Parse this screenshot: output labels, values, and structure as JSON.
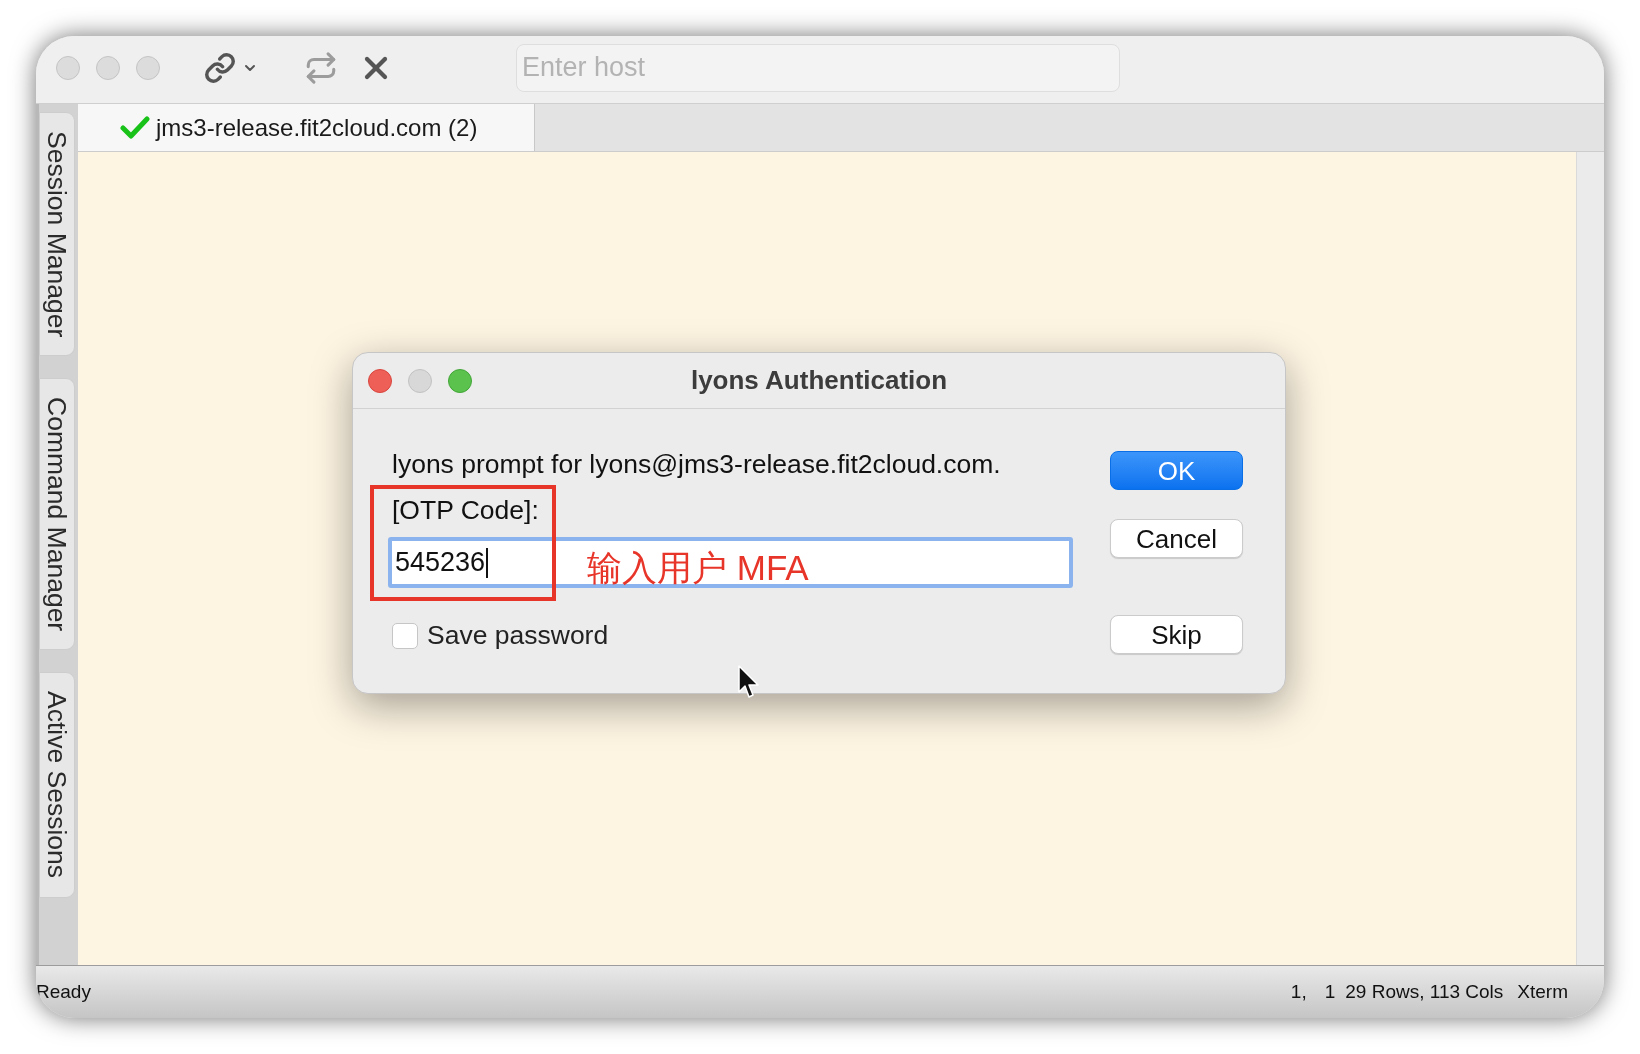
{
  "toolbar": {
    "host_field": {
      "placeholder": "Enter host"
    }
  },
  "tabs": [
    {
      "label": "jms3-release.fit2cloud.com (2)",
      "selected": true,
      "connected": true
    }
  ],
  "sidebar": {
    "items": [
      {
        "label": "Session Manager"
      },
      {
        "label": "Command Manager"
      },
      {
        "label": "Active Sessions"
      }
    ]
  },
  "dialog": {
    "title": "lyons Authentication",
    "prompt": "lyons prompt for lyons@jms3-release.fit2cloud.com.",
    "field_label": "[OTP Code]:",
    "otp_field": {
      "value": "545236",
      "focused": true
    },
    "save_password": {
      "label": "Save password",
      "checked": false
    },
    "buttons": [
      {
        "label": "OK",
        "kind": "primary"
      },
      {
        "label": "Cancel",
        "kind": "secondary"
      },
      {
        "label": "Skip",
        "kind": "secondary"
      }
    ]
  },
  "annotation": {
    "text": "输入用户 MFA"
  },
  "status_bar": {
    "message": "Ready",
    "cursor_line": "1,",
    "cursor_column": "1",
    "dimensions": "29 Rows, 113 Cols",
    "terminal_type": "Xterm"
  }
}
